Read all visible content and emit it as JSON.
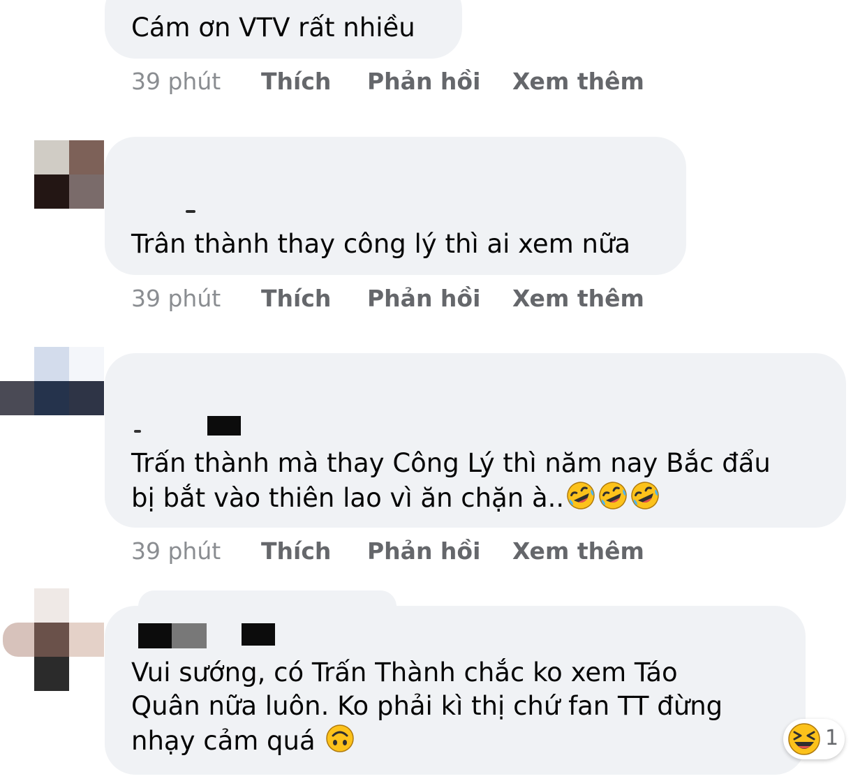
{
  "colors": {
    "bubble_bg": "#f0f2f5",
    "comment_text": "#050505",
    "action_text": "#65676b",
    "time_text": "#8a8d91",
    "emoji_face": "#fcc21b"
  },
  "comments": [
    {
      "text": "Cám ơn VTV rất nhiều",
      "time": "39 phút",
      "like": "Thích",
      "reply": "Phản hồi",
      "more": "Xem thêm"
    },
    {
      "text": "Trân thành thay công lý thì ai xem nữa",
      "time": "39 phút",
      "like": "Thích",
      "reply": "Phản hồi",
      "more": "Xem thêm"
    },
    {
      "text": "Trấn thành mà thay Công Lý thì năm nay Bắc đẩu\nbị bắt vào thiên lao vì ăn chặn à..",
      "emojis": [
        "rolling-on-floor-laughing",
        "rolling-on-floor-laughing",
        "rolling-on-floor-laughing"
      ],
      "time": "39 phút",
      "like": "Thích",
      "reply": "Phản hồi",
      "more": "Xem thêm"
    },
    {
      "text": "Vui sướng, có Trấn Thành chắc ko xem Táo\nQuân nữa luôn. Ko phải kì thị chứ fan TT đừng\nnhạy cảm quá ",
      "emojis": [
        "upside-down-face"
      ],
      "reaction": {
        "icon": "laughing-squint-icon",
        "count": "1"
      }
    }
  ]
}
